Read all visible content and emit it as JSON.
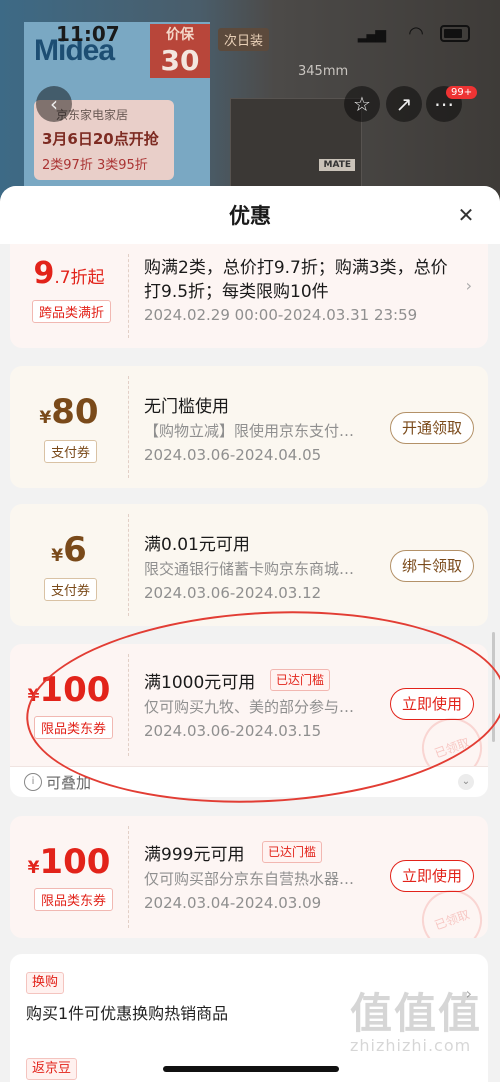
{
  "status_bar": {
    "time": "11:07"
  },
  "background": {
    "brand": "Midea",
    "promo_badge": "价保",
    "promo_badge_num": "30",
    "next_day": "次日装",
    "event_store": "京东家电家居",
    "event_date": "3月6日20点开抢",
    "event_discount": "2类97折 3类95折",
    "dimension": "345mm",
    "mate": "MATE",
    "cart_badge": "99+"
  },
  "sheet": {
    "title": "优惠",
    "coupons": [
      {
        "amount_num": "9",
        "amount_suffix": ".7折起",
        "tag": "跨品类满折",
        "title": "购满2类，总价打9.7折；购满3类，总价打9.5折；每类限购10件",
        "date": "2024.02.29 00:00-2024.03.31 23:59"
      },
      {
        "currency": "¥",
        "amount_num": "80",
        "tag": "支付券",
        "title": "无门槛使用",
        "desc": "【购物立减】限使用京东支付…",
        "date": "2024.03.06-2024.04.05",
        "button": "开通领取"
      },
      {
        "currency": "¥",
        "amount_num": "6",
        "tag": "支付券",
        "title": "满0.01元可用",
        "desc": "限交通银行储蓄卡购京东商城…",
        "date": "2024.03.06-2024.03.12",
        "button": "绑卡领取"
      },
      {
        "currency": "¥",
        "amount_num": "100",
        "tag": "限品类东券",
        "title": "满1000元可用",
        "threshold": "已达门槛",
        "desc": "仅可购买九牧、美的部分参与…",
        "date": "2024.03.06-2024.03.15",
        "button": "立即使用",
        "stamp": "已领取",
        "stackable": "可叠加"
      },
      {
        "currency": "¥",
        "amount_num": "100",
        "tag": "限品类东券",
        "title": "满999元可用",
        "threshold": "已达门槛",
        "desc": "仅可购买部分京东自营热水器…",
        "date": "2024.03.04-2024.03.09",
        "button": "立即使用",
        "stamp": "已领取"
      }
    ],
    "exchange": {
      "tag": "换购",
      "text": "购买1件可优惠换购热销商品"
    },
    "jingdou": {
      "tag": "返京豆"
    }
  },
  "watermark": {
    "big": "值值值",
    "small": "zhizhizhi.com"
  },
  "colors": {
    "accent_red": "#e2231a",
    "gold_brown": "#7a4a1a",
    "annotation": "#e23d34"
  }
}
